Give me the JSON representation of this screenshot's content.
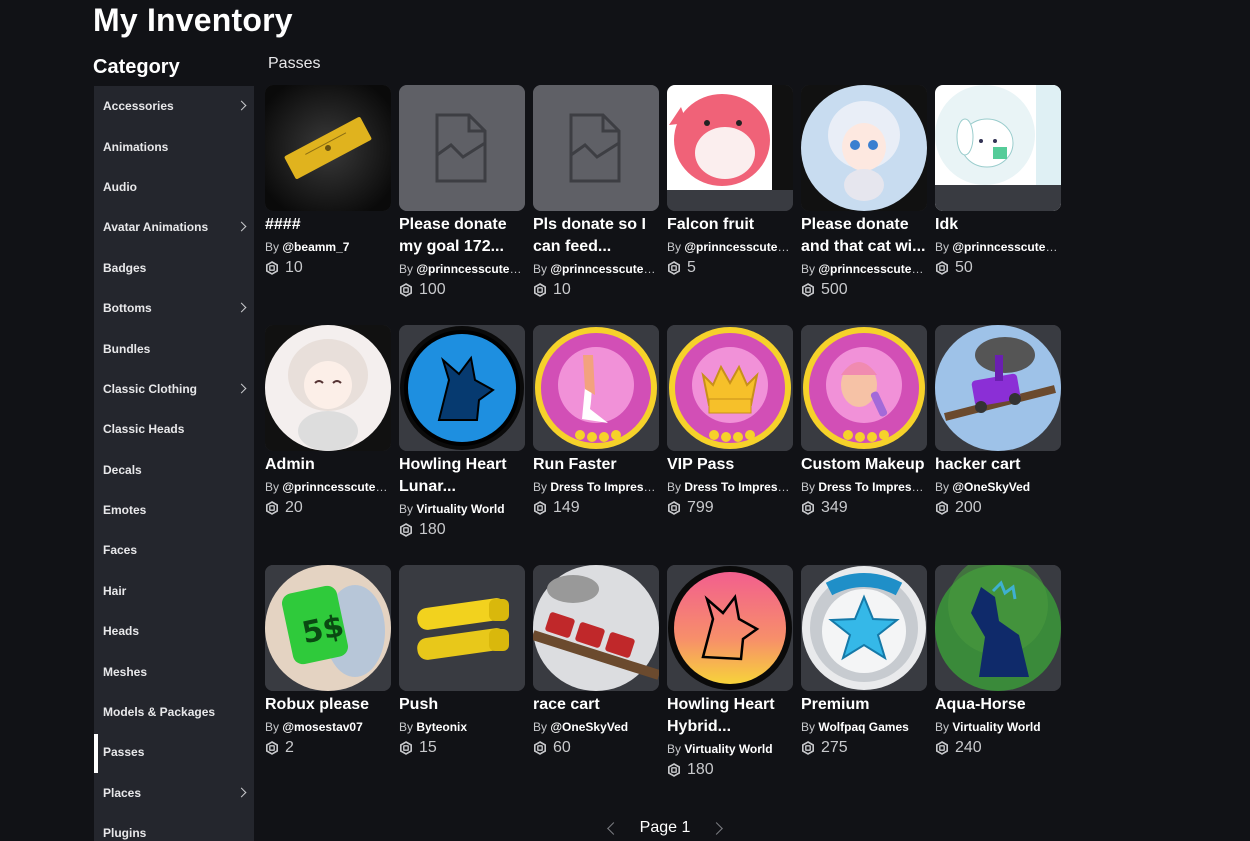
{
  "header": {
    "title": "My Inventory"
  },
  "sidebar": {
    "title": "Category",
    "items": [
      {
        "label": "Accessories",
        "chevron": true
      },
      {
        "label": "Animations",
        "chevron": false
      },
      {
        "label": "Audio",
        "chevron": false
      },
      {
        "label": "Avatar Animations",
        "chevron": true
      },
      {
        "label": "Badges",
        "chevron": false
      },
      {
        "label": "Bottoms",
        "chevron": true
      },
      {
        "label": "Bundles",
        "chevron": false
      },
      {
        "label": "Classic Clothing",
        "chevron": true
      },
      {
        "label": "Classic Heads",
        "chevron": false
      },
      {
        "label": "Decals",
        "chevron": false
      },
      {
        "label": "Emotes",
        "chevron": false
      },
      {
        "label": "Faces",
        "chevron": false
      },
      {
        "label": "Hair",
        "chevron": false
      },
      {
        "label": "Heads",
        "chevron": false
      },
      {
        "label": "Meshes",
        "chevron": false
      },
      {
        "label": "Models & Packages",
        "chevron": false
      },
      {
        "label": "Passes",
        "chevron": false,
        "active": true
      },
      {
        "label": "Places",
        "chevron": true
      },
      {
        "label": "Plugins",
        "chevron": false
      }
    ]
  },
  "main": {
    "section_title": "Passes",
    "items": [
      {
        "name": "####",
        "by": "By",
        "creator": "@beamm_7",
        "price": "10",
        "thumb": "ticket-icon"
      },
      {
        "name": "Please donate my goal 172...",
        "by": "By",
        "creator": "@prinncesscutec...",
        "price": "100",
        "thumb": "placeholder-image-icon"
      },
      {
        "name": "Pls donate so I can feed...",
        "by": "By",
        "creator": "@prinncesscutec...",
        "price": "10",
        "thumb": "placeholder-image-icon"
      },
      {
        "name": "Falcon fruit",
        "by": "By",
        "creator": "@prinncesscutec...",
        "price": "5",
        "thumb": "pink-plush-image"
      },
      {
        "name": "Please donate and that cat wi...",
        "by": "By",
        "creator": "@prinncesscutec...",
        "price": "500",
        "thumb": "anime-girl-cat-image"
      },
      {
        "name": "Idk",
        "by": "By",
        "creator": "@prinncesscutec...",
        "price": "50",
        "thumb": "white-bunny-image"
      },
      {
        "name": "Admin",
        "by": "By",
        "creator": "@prinncesscutec...",
        "price": "20",
        "thumb": "anime-girl-image"
      },
      {
        "name": "Howling Heart Lunar...",
        "by": "By",
        "creator": "Virtuality World",
        "price": "180",
        "thumb": "blue-wolf-image"
      },
      {
        "name": "Run Faster",
        "by": "By",
        "creator": "Dress To Impress ...",
        "price": "149",
        "thumb": "heel-badge-image"
      },
      {
        "name": "VIP Pass",
        "by": "By",
        "creator": "Dress To Impress ...",
        "price": "799",
        "thumb": "vip-crown-badge-image"
      },
      {
        "name": "Custom Makeup",
        "by": "By",
        "creator": "Dress To Impress ...",
        "price": "349",
        "thumb": "makeup-badge-image"
      },
      {
        "name": "hacker cart",
        "by": "By",
        "creator": "@OneSkyVed",
        "price": "200",
        "thumb": "purple-cart-image"
      },
      {
        "name": "Robux please",
        "by": "By",
        "creator": "@mosestav07",
        "price": "2",
        "thumb": "green-sign-image"
      },
      {
        "name": "Push",
        "by": "By",
        "creator": "Byteonix",
        "price": "15",
        "thumb": "yellow-arms-image"
      },
      {
        "name": "race cart",
        "by": "By",
        "creator": "@OneSkyVed",
        "price": "60",
        "thumb": "red-cart-image"
      },
      {
        "name": "Howling Heart Hybrid...",
        "by": "By",
        "creator": "Virtuality World",
        "price": "180",
        "thumb": "sunset-wolf-image"
      },
      {
        "name": "Premium",
        "by": "By",
        "creator": "Wolfpaq Games",
        "price": "275",
        "thumb": "premium-star-image"
      },
      {
        "name": "Aqua-Horse",
        "by": "By",
        "creator": "Virtuality World",
        "price": "240",
        "thumb": "blue-horse-image"
      }
    ]
  },
  "pagination": {
    "label": "Page 1"
  },
  "colors": {
    "background": "#111216",
    "sidebar": "#24262d",
    "card": "#393b41",
    "text_secondary": "#c8c9cc"
  }
}
